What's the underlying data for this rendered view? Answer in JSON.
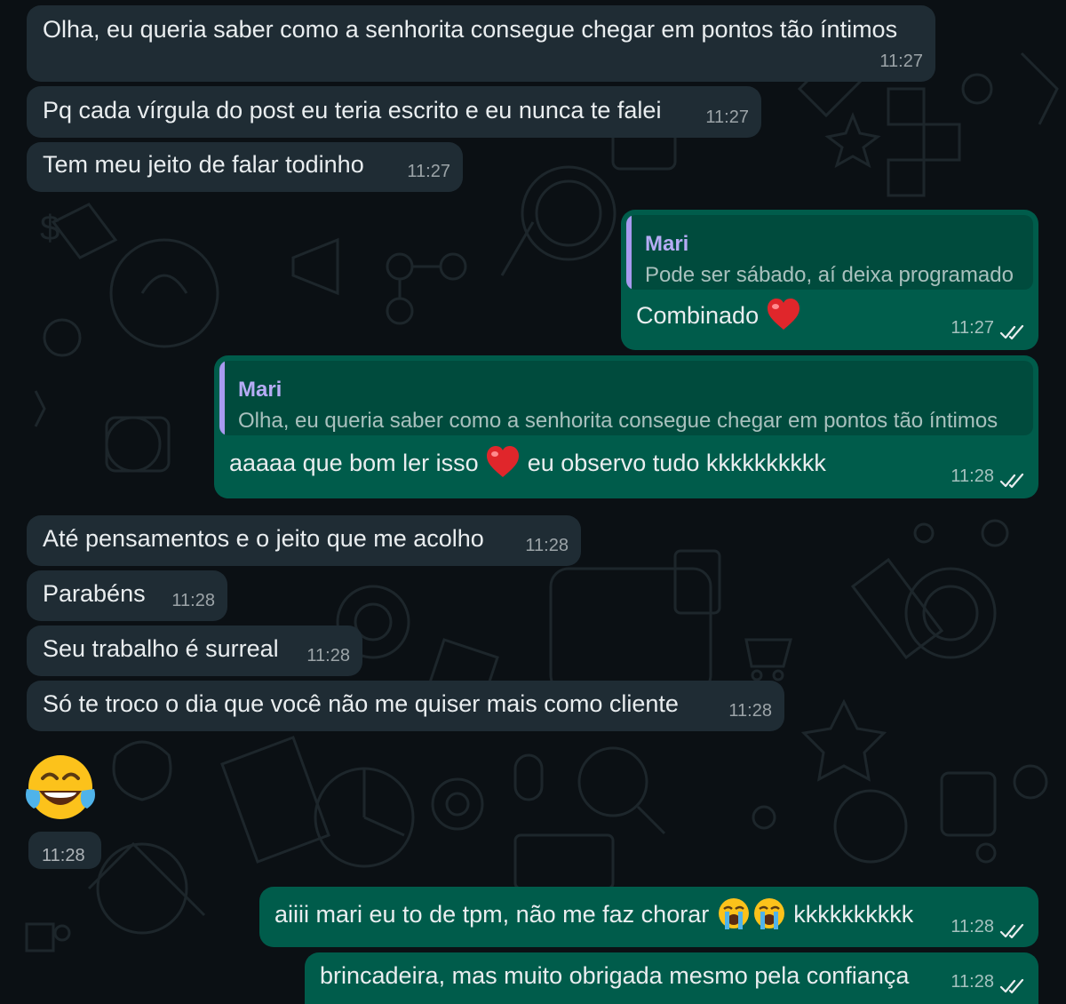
{
  "chat": {
    "messages": [
      {
        "text": "Olha, eu queria saber como a senhorita consegue chegar em pontos tão íntimos",
        "time": "11:27"
      },
      {
        "text": "Pq cada vírgula do post eu teria escrito e eu nunca te falei",
        "time": "11:27"
      },
      {
        "text": "Tem meu jeito de falar todinho",
        "time": "11:27"
      },
      {
        "reply_name": "Mari",
        "reply_text": "Pode ser sábado, aí deixa programado",
        "text": "Combinado",
        "emoji": "heart",
        "time": "11:27",
        "status": "read"
      },
      {
        "reply_name": "Mari",
        "reply_text": "Olha, eu queria saber como a senhorita consegue chegar em pontos tão íntimos",
        "text_before": "aaaaa que bom ler isso",
        "emoji": "heart",
        "text_after": "eu observo tudo kkkkkkkkkk",
        "time": "11:28",
        "status": "read"
      },
      {
        "text": "Até pensamentos e o jeito que me acolho",
        "time": "11:28"
      },
      {
        "text": "Parabéns",
        "time": "11:28"
      },
      {
        "text": "Seu trabalho é surreal",
        "time": "11:28"
      },
      {
        "text": "Só te troco o dia que você não me quiser mais como cliente",
        "time": "11:28"
      },
      {
        "emoji": "face-with-tears-of-joy",
        "time": "11:28"
      },
      {
        "text_before": "aiiii mari eu to de tpm, não me faz chorar",
        "emoji": "loudly-crying-face-x2",
        "text_after": "kkkkkkkkkk",
        "time": "11:28",
        "status": "read"
      },
      {
        "text": "brincadeira, mas muito obrigada mesmo pela confiança",
        "time": "11:28",
        "status": "read"
      }
    ]
  },
  "colors": {
    "background": "#0b1014",
    "incoming_bubble": "#1f2c34",
    "outgoing_bubble": "#005c4b",
    "read_ticks": "#e9edef",
    "quote_name": "#b6acf5"
  },
  "icons": [
    "double-check-icon",
    "heart-emoji",
    "face-with-tears-of-joy-emoji",
    "loudly-crying-face-emoji"
  ]
}
